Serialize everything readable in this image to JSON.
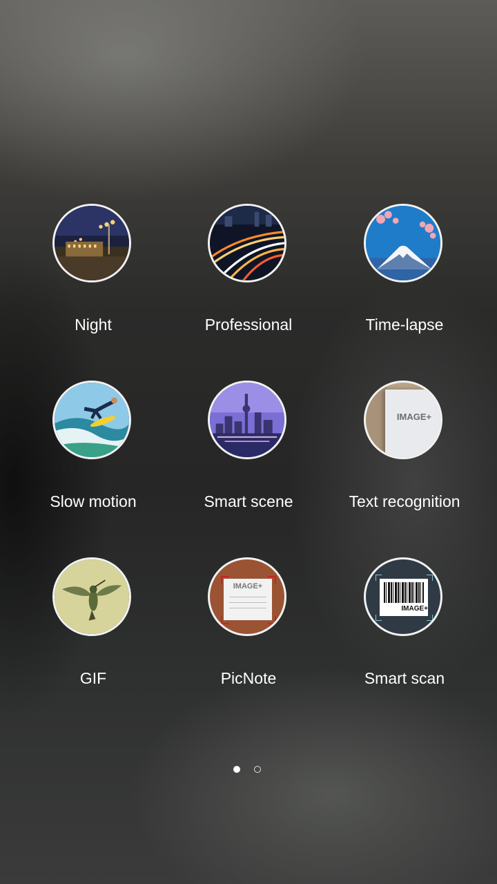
{
  "modes": [
    {
      "label": "Night",
      "icon": "night-city-icon"
    },
    {
      "label": "Professional",
      "icon": "light-trails-icon"
    },
    {
      "label": "Time-lapse",
      "icon": "mount-fuji-icon"
    },
    {
      "label": "Slow motion",
      "icon": "surfer-icon"
    },
    {
      "label": "Smart scene",
      "icon": "city-skyline-icon"
    },
    {
      "label": "Text recognition",
      "icon": "document-icon",
      "badge_text": "IMAGE+"
    },
    {
      "label": "GIF",
      "icon": "hummingbird-icon"
    },
    {
      "label": "PicNote",
      "icon": "note-paper-icon",
      "badge_text": "IMAGE+"
    },
    {
      "label": "Smart scan",
      "icon": "barcode-icon",
      "badge_text": "IMAGE+"
    }
  ],
  "pager": {
    "pages": 2,
    "current": 1
  }
}
